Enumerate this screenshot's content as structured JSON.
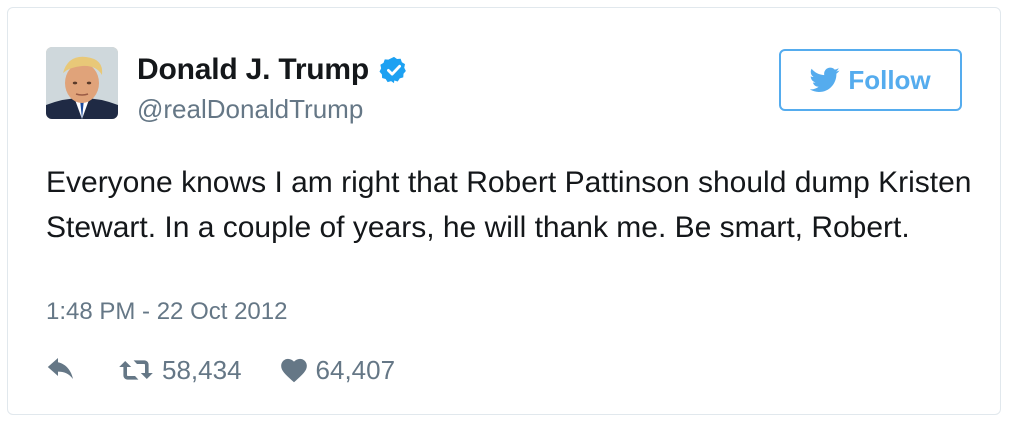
{
  "tweet": {
    "author": {
      "name": "Donald J. Trump",
      "handle": "@realDonaldTrump",
      "verified": true
    },
    "follow_label": "Follow",
    "text": "Everyone knows I am right that Robert Pattinson should dump Kristen Stewart. In a couple of years, he will thank me. Be smart, Robert.",
    "timestamp": "1:48 PM - 22 Oct 2012",
    "retweets": "58,434",
    "likes": "64,407"
  },
  "icons": {
    "verified": "verified-badge-icon",
    "follow": "twitter-bird-icon",
    "reply": "reply-icon",
    "retweet": "retweet-icon",
    "like": "heart-icon"
  },
  "colors": {
    "accent": "#55acee",
    "verified": "#1da1f2",
    "muted": "#657786",
    "text": "#14171a",
    "border": "#e1e8ed"
  }
}
